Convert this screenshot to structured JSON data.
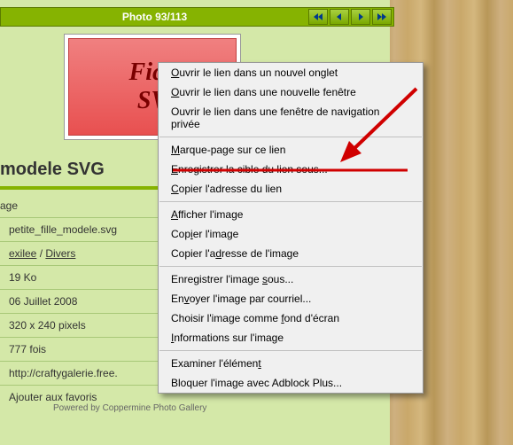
{
  "navbar": {
    "counter": "Photo 93/113"
  },
  "card": {
    "line1": "Fick",
    "line2": "SV"
  },
  "heading": "modele SVG",
  "info_label": "age",
  "info": {
    "filename": "petite_fille_modele.svg",
    "album_user": "exilee",
    "album_sep": " / ",
    "album_cat": "Divers",
    "size": "19 Ko",
    "date": "06 Juillet 2008",
    "dims": "320 x 240 pixels",
    "views": "777 fois",
    "url": "http://craftygalerie.free.",
    "fav": "Ajouter aux favoris"
  },
  "ctx": {
    "open_tab": "uvrir le lien dans un nouvel onglet",
    "open_win": "uvrir le lien dans une nouvelle fenêtre",
    "open_priv": "Ouvrir le lien dans une fenêtre de navigation privée",
    "bookmark": "arque-page sur ce lien",
    "save_target": "nregistrer la cible du lien sous...",
    "copy_link": "opier l'adresse du lien",
    "show_img": "fficher l'image",
    "copy_img": "Cop",
    "copy_img2": "er l'image",
    "copy_img_addr": "Copier l'a",
    "copy_img_addr2": "resse de l'image",
    "save_img": "Enregistrer l'image ",
    "save_img2": "ous...",
    "email_img": "En",
    "email_img2": "oyer l'image par courriel...",
    "wallpaper": "Choisir l'image comme ",
    "wallpaper2": "ond d'écran",
    "img_info": "nformations sur l'image",
    "inspect": "Examiner l'élémen",
    "adblock": "Bloquer l'image avec Adblock Plus..."
  },
  "footer": "Powered by Coppermine Photo Gallery"
}
